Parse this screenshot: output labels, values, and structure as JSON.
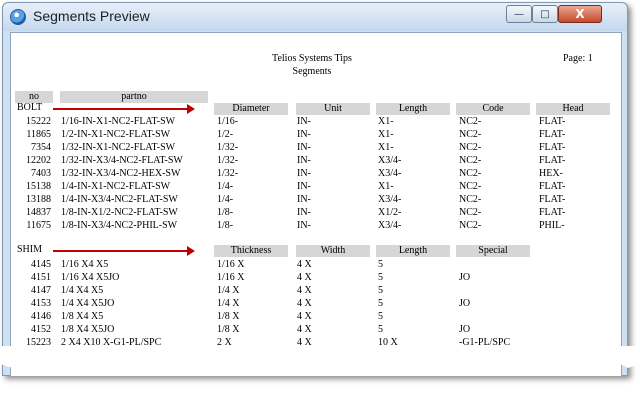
{
  "window": {
    "title": "Segments Preview",
    "close_glyph": "X"
  },
  "report": {
    "company": "Telios Systems Tips",
    "name": "Segments",
    "page": "Page: 1"
  },
  "top_headers": {
    "no": "no",
    "partno": "partno"
  },
  "bolt": {
    "label": "BOLT",
    "headers": [
      "Diameter",
      "Unit",
      "Length",
      "Code",
      "Head"
    ],
    "rows": [
      {
        "no": "15222",
        "partno": "1/16-IN-X1-NC2-FLAT-SW",
        "diameter": "1/16-",
        "unit": "IN-",
        "length": "X1-",
        "code": "NC2-",
        "head": "FLAT-"
      },
      {
        "no": "11865",
        "partno": "1/2-IN-X1-NC2-FLAT-SW",
        "diameter": "1/2-",
        "unit": "IN-",
        "length": "X1-",
        "code": "NC2-",
        "head": "FLAT-"
      },
      {
        "no": "7354",
        "partno": "1/32-IN-X1-NC2-FLAT-SW",
        "diameter": "1/32-",
        "unit": "IN-",
        "length": "X1-",
        "code": "NC2-",
        "head": "FLAT-"
      },
      {
        "no": "12202",
        "partno": "1/32-IN-X3/4-NC2-FLAT-SW",
        "diameter": "1/32-",
        "unit": "IN-",
        "length": "X3/4-",
        "code": "NC2-",
        "head": "FLAT-"
      },
      {
        "no": "7403",
        "partno": "1/32-IN-X3/4-NC2-HEX-SW",
        "diameter": "1/32-",
        "unit": "IN-",
        "length": "X3/4-",
        "code": "NC2-",
        "head": "HEX-"
      },
      {
        "no": "15138",
        "partno": "1/4-IN-X1-NC2-FLAT-SW",
        "diameter": "1/4-",
        "unit": "IN-",
        "length": "X1-",
        "code": "NC2-",
        "head": "FLAT-"
      },
      {
        "no": "13188",
        "partno": "1/4-IN-X3/4-NC2-FLAT-SW",
        "diameter": "1/4-",
        "unit": "IN-",
        "length": "X3/4-",
        "code": "NC2-",
        "head": "FLAT-"
      },
      {
        "no": "14837",
        "partno": "1/8-IN-X1/2-NC2-FLAT-SW",
        "diameter": "1/8-",
        "unit": "IN-",
        "length": "X1/2-",
        "code": "NC2-",
        "head": "FLAT-"
      },
      {
        "no": "11675",
        "partno": "1/8-IN-X3/4-NC2-PHIL-SW",
        "diameter": "1/8-",
        "unit": "IN-",
        "length": "X3/4-",
        "code": "NC2-",
        "head": "PHIL-"
      }
    ]
  },
  "shim": {
    "label": "SHIM",
    "headers": [
      "Thickness",
      "Width",
      "Length",
      "Special"
    ],
    "rows": [
      {
        "no": "4145",
        "partno": "1/16 X4 X5",
        "thickness": "1/16 X",
        "width": "4 X",
        "length": "5",
        "special": ""
      },
      {
        "no": "4151",
        "partno": "1/16 X4 X5JO",
        "thickness": "1/16 X",
        "width": "4 X",
        "length": "5",
        "special": "JO"
      },
      {
        "no": "4147",
        "partno": "1/4 X4 X5",
        "thickness": "1/4 X",
        "width": "4 X",
        "length": "5",
        "special": ""
      },
      {
        "no": "4153",
        "partno": "1/4 X4 X5JO",
        "thickness": "1/4 X",
        "width": "4 X",
        "length": "5",
        "special": "JO"
      },
      {
        "no": "4146",
        "partno": "1/8 X4 X5",
        "thickness": "1/8 X",
        "width": "4 X",
        "length": "5",
        "special": ""
      },
      {
        "no": "4152",
        "partno": "1/8 X4 X5JO",
        "thickness": "1/8 X",
        "width": "4 X",
        "length": "5",
        "special": "JO"
      },
      {
        "no": "15223",
        "partno": "2 X4 X10 X-G1-PL/SPC",
        "thickness": "2 X",
        "width": "4 X",
        "length": "10 X",
        "special": "-G1-PL/SPC"
      }
    ]
  },
  "colors": {
    "arrow": "#c00000",
    "header_bg": "#d6d6d6",
    "frame": "#cfe0f2"
  }
}
